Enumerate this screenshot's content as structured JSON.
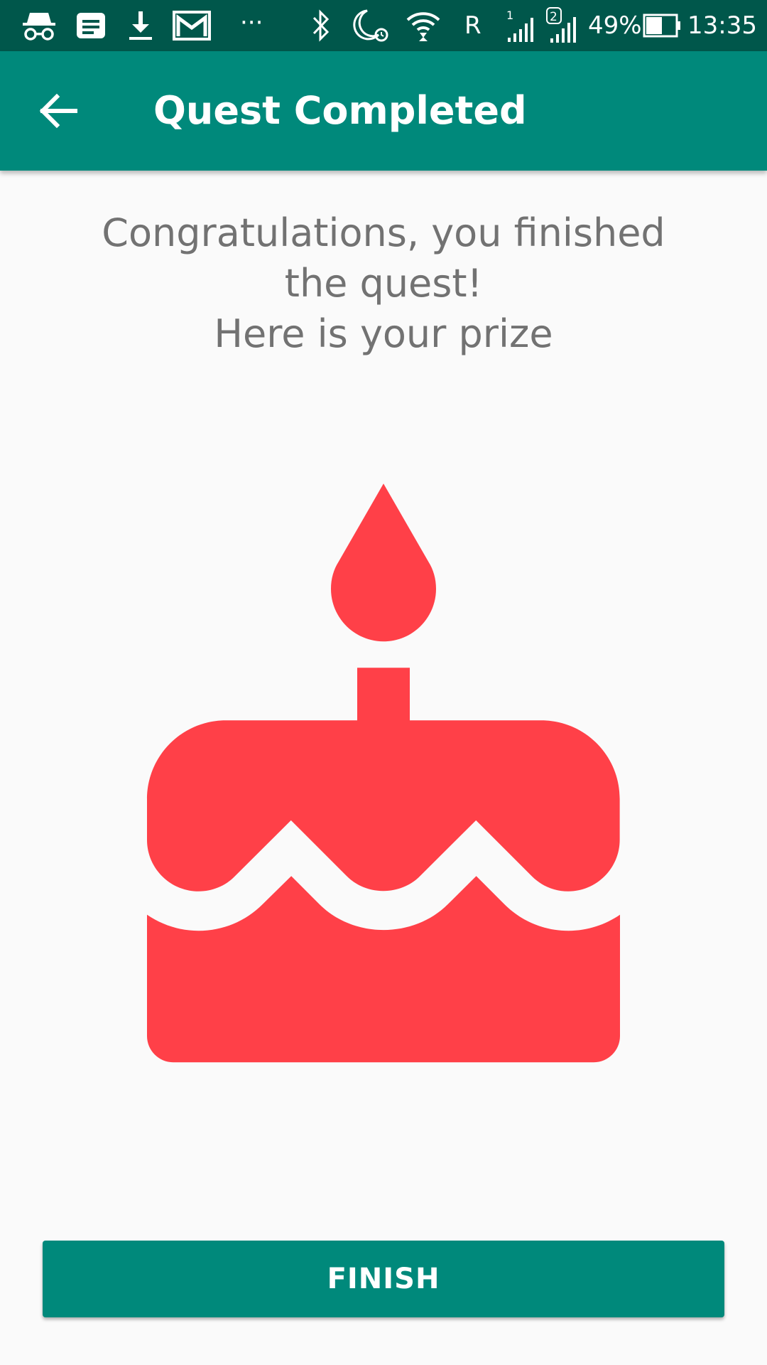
{
  "status_bar": {
    "battery_percent": "49%",
    "time": "13:35",
    "roaming": "R",
    "sim1_label": "1",
    "sim2_label": "2",
    "overflow": "···",
    "icons": [
      "incognito-icon",
      "news-icon",
      "download-icon",
      "gmail-icon",
      "more-icon",
      "bluetooth-icon",
      "do-not-disturb-alarm-icon",
      "wifi-icon",
      "signal-sim1-icon",
      "signal-sim2-icon",
      "battery-icon"
    ]
  },
  "app_bar": {
    "title": "Quest Completed",
    "back_icon": "arrow-back-icon",
    "color": "#00897b"
  },
  "message": {
    "line1": "Congratulations, you finished",
    "line2": "the quest!",
    "line3": "Here is your prize"
  },
  "prize": {
    "icon": "cake-icon",
    "color": "#ff4048"
  },
  "finish_button": {
    "label": "FINISH",
    "color": "#00897b"
  }
}
